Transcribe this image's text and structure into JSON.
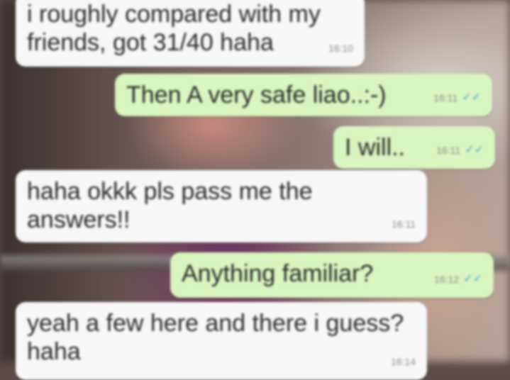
{
  "messages": [
    {
      "direction": "incoming",
      "text": "i roughly compared with my friends, got 31/40 haha",
      "time": "16:10"
    },
    {
      "direction": "outgoing",
      "text": "Then A very safe liao..:-)",
      "time": "16:11",
      "status_icon": "read-checkmarks-icon"
    },
    {
      "direction": "outgoing",
      "text": "I will..",
      "time": "16:11",
      "status_icon": "read-checkmarks-icon"
    },
    {
      "direction": "incoming",
      "text": "haha okkk pls pass me the answers!!",
      "time": "16:11"
    },
    {
      "direction": "outgoing",
      "text": "Anything familiar?",
      "time": "16:12",
      "status_icon": "read-checkmarks-icon"
    },
    {
      "direction": "incoming",
      "text": "yeah a few here and there i guess? haha",
      "time": "16:14"
    }
  ],
  "colors": {
    "incoming_bubble": "#f7f7f7",
    "outgoing_bubble": "#d9f5c0",
    "read_check": "#45a3e0"
  }
}
